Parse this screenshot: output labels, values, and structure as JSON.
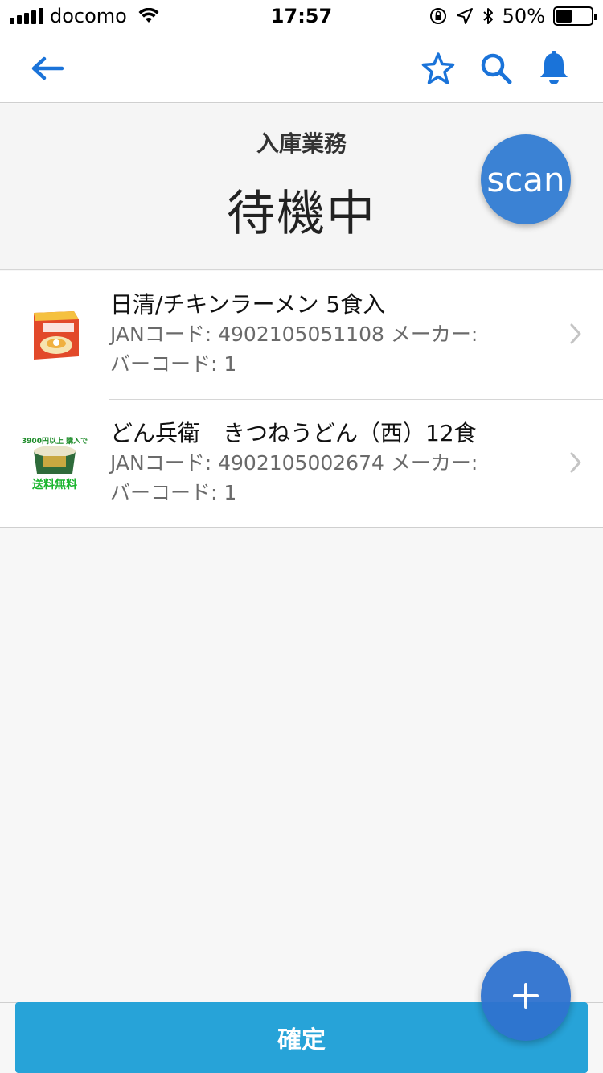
{
  "status_bar": {
    "carrier": "docomo",
    "time": "17:57",
    "battery": "50%",
    "battery_level": 0.5
  },
  "nav": {
    "icons": [
      "back-arrow-icon",
      "star-icon",
      "search-icon",
      "bell-icon"
    ],
    "accent_color": "#1a73d9"
  },
  "header": {
    "subtitle": "入庫業務",
    "status": "待機中",
    "scan_label": "scan"
  },
  "items": [
    {
      "title": "日清/チキンラーメン 5食入",
      "jan_line": "JANコード: 4902105051108 メーカー:",
      "barcode_line": "バーコード: 1"
    },
    {
      "title": "どん兵衛　きつねうどん（西）12食",
      "jan_line": "JANコード: 4902105002674 メーカー:",
      "barcode_line": "バーコード: 1"
    }
  ],
  "actions": {
    "confirm_label": "確定",
    "fab_icon": "plus-icon"
  },
  "colors": {
    "scan_button": "#3b82d4",
    "confirm_button": "#27a3d8",
    "fab": "#2f73cf"
  }
}
